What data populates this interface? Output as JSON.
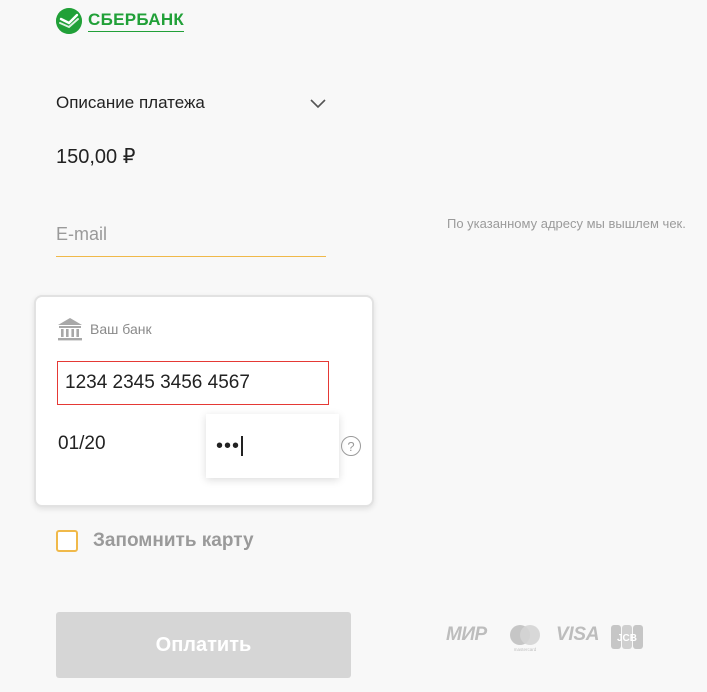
{
  "brand": {
    "name": "СБЕРБАНК",
    "color": "#21a038"
  },
  "payment": {
    "description_label": "Описание платежа",
    "amount": "150,00 ₽"
  },
  "email": {
    "placeholder": "E-mail",
    "value": "",
    "hint": "По указанному адресу мы вышлем чек."
  },
  "card": {
    "bank_label": "Ваш банк",
    "number": "1234 2345 3456 4567",
    "expiry": "01/20",
    "cvc_masked": "•••",
    "help": "?"
  },
  "remember": {
    "label": "Запомнить карту",
    "checked": false
  },
  "pay_button": {
    "label": "Оплатить"
  },
  "payment_systems": {
    "mir": "МИР",
    "visa": "VISA",
    "mastercard_caption": "mastercard",
    "jcb": "JCB"
  },
  "colors": {
    "accent": "#f0b94a",
    "error": "#e53935",
    "muted": "#9b9b9b",
    "button_disabled": "#d6d6d6"
  }
}
